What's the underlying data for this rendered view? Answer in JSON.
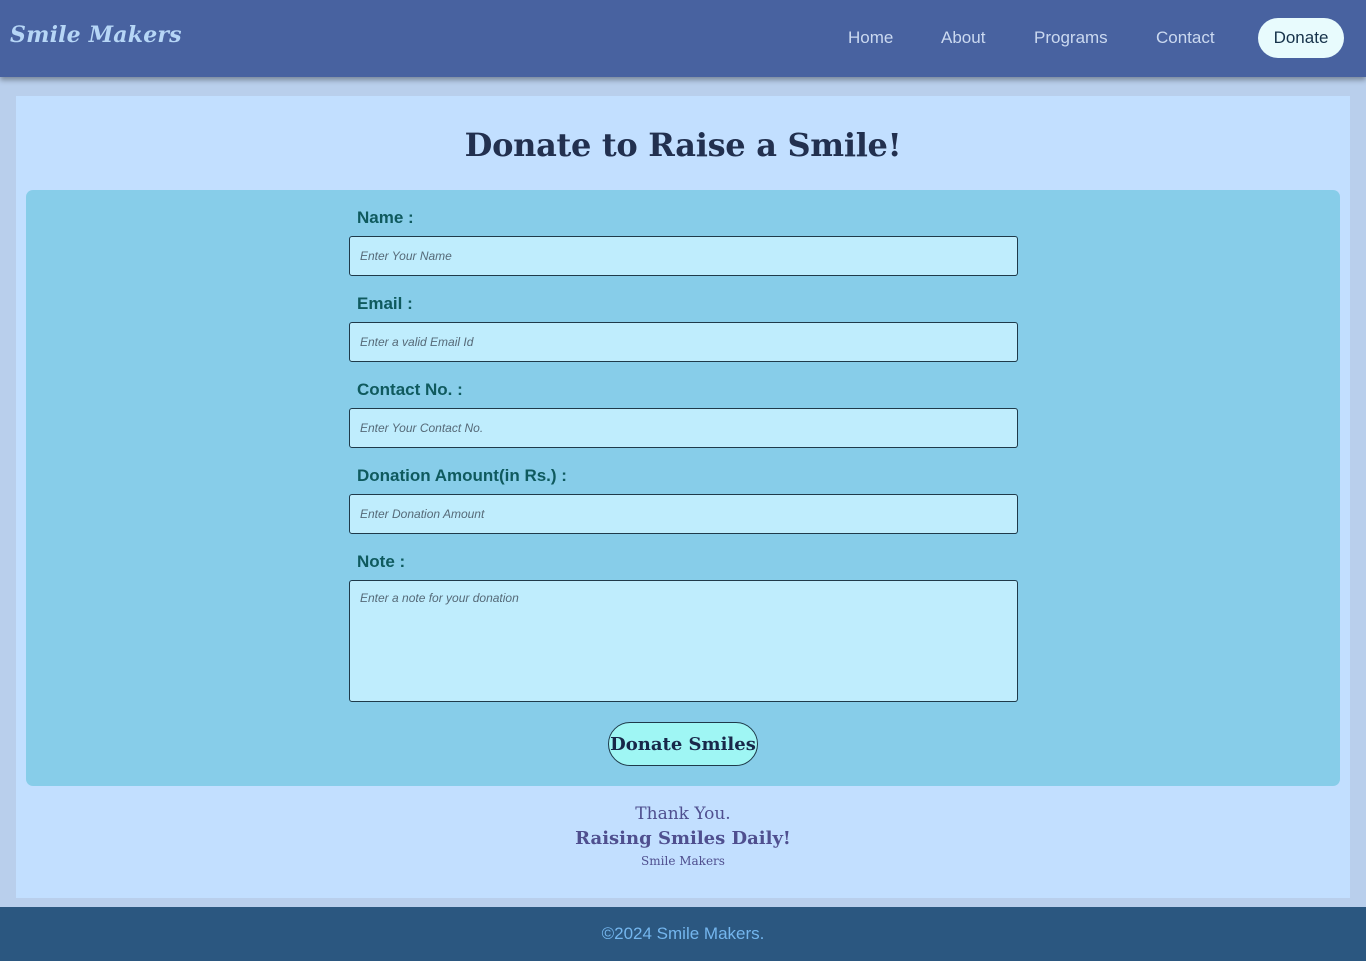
{
  "header": {
    "brand": "Smile Makers",
    "nav": {
      "home": "Home",
      "about": "About",
      "programs": "Programs",
      "contact": "Contact",
      "donate": "Donate"
    }
  },
  "main": {
    "title": "Donate to Raise a Smile!",
    "form": {
      "name_label": "Name :",
      "name_placeholder": "Enter Your Name",
      "email_label": "Email :",
      "email_placeholder": "Enter a valid Email Id",
      "contact_label": "Contact No. :",
      "contact_placeholder": "Enter Your Contact No.",
      "amount_label": "Donation Amount(in Rs.) :",
      "amount_placeholder": "Enter Donation Amount",
      "note_label": "Note :",
      "note_placeholder": "Enter a note for your donation",
      "submit_label": "Donate Smiles"
    },
    "thanks": {
      "line1": "Thank You.",
      "line2": "Raising Smiles Daily!",
      "line3": "Smile Makers"
    }
  },
  "footer": {
    "copyright": "©2024 Smile Makers."
  },
  "colors": {
    "header_bg": "#4862a0",
    "page_bg": "#c2dfff",
    "form_bg": "#87cde9",
    "input_bg": "#bfedfd",
    "submit_bg": "#9ff6f4",
    "footer_bg": "#2b5780",
    "footer_text": "#74b6ee"
  }
}
